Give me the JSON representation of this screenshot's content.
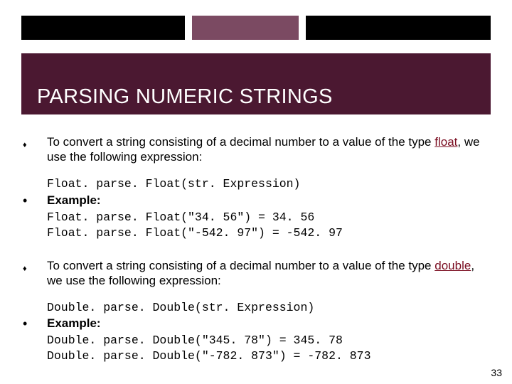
{
  "header": {
    "title": "PARSING NUMERIC STRINGS"
  },
  "bullets": {
    "b1_pre": "To convert a string consisting of a decimal number to a value of the type ",
    "b1_kw": "float",
    "b1_post": ", we use the following expression:",
    "float_expr": "Float. parse. Float(str. Expression)",
    "example_label": "Example:",
    "float_ex1": "Float. parse. Float(\"34. 56\") = 34. 56",
    "float_ex2": "Float. parse. Float(\"-542. 97\") = -542. 97",
    "b2_pre": "To convert a string consisting of a decimal number to a value of the type ",
    "b2_kw": "double",
    "b2_post": ", we use the following expression:",
    "double_expr": "Double. parse. Double(str. Expression)",
    "double_ex1": "Double. parse. Double(\"345. 78\") = 345. 78",
    "double_ex2": "Double. parse. Double(\"-782. 873\") = -782. 873"
  },
  "page_number": "33"
}
